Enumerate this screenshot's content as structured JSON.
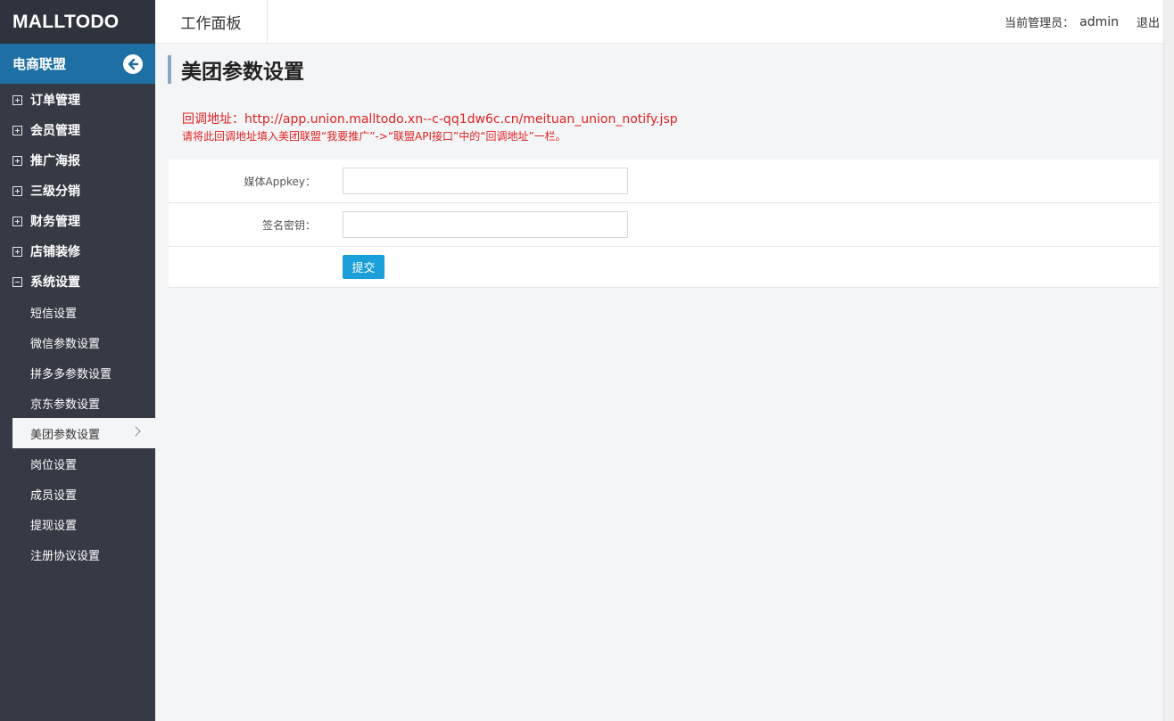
{
  "brand": "MALLTODO",
  "sidebar": {
    "section_title": "电商联盟",
    "groups": [
      {
        "label": "订单管理"
      },
      {
        "label": "会员管理"
      },
      {
        "label": "推广海报"
      },
      {
        "label": "三级分销"
      },
      {
        "label": "财务管理"
      },
      {
        "label": "店铺装修"
      },
      {
        "label": "系统设置"
      }
    ],
    "sub_items": [
      {
        "label": "短信设置"
      },
      {
        "label": "微信参数设置"
      },
      {
        "label": "拼多多参数设置"
      },
      {
        "label": "京东参数设置"
      },
      {
        "label": "美团参数设置"
      },
      {
        "label": "岗位设置"
      },
      {
        "label": "成员设置"
      },
      {
        "label": "提现设置"
      },
      {
        "label": "注册协议设置"
      }
    ]
  },
  "topbar": {
    "workspace": "工作面板",
    "admin_label": "当前管理员：",
    "admin_name": "admin",
    "logout": "退出"
  },
  "main": {
    "title": "美团参数设置",
    "callback_line": "回调地址：http://app.union.malltodo.xn--c-qq1dw6c.cn/meituan_union_notify.jsp",
    "hint_line": "请将此回调地址填入美团联盟“我要推广”->“联盟API接口”中的“回调地址”一栏。",
    "form": {
      "appkey_label": "媒体Appkey：",
      "appkey_value": "",
      "secret_label": "签名密钥：",
      "secret_value": "",
      "submit": "提交"
    }
  }
}
